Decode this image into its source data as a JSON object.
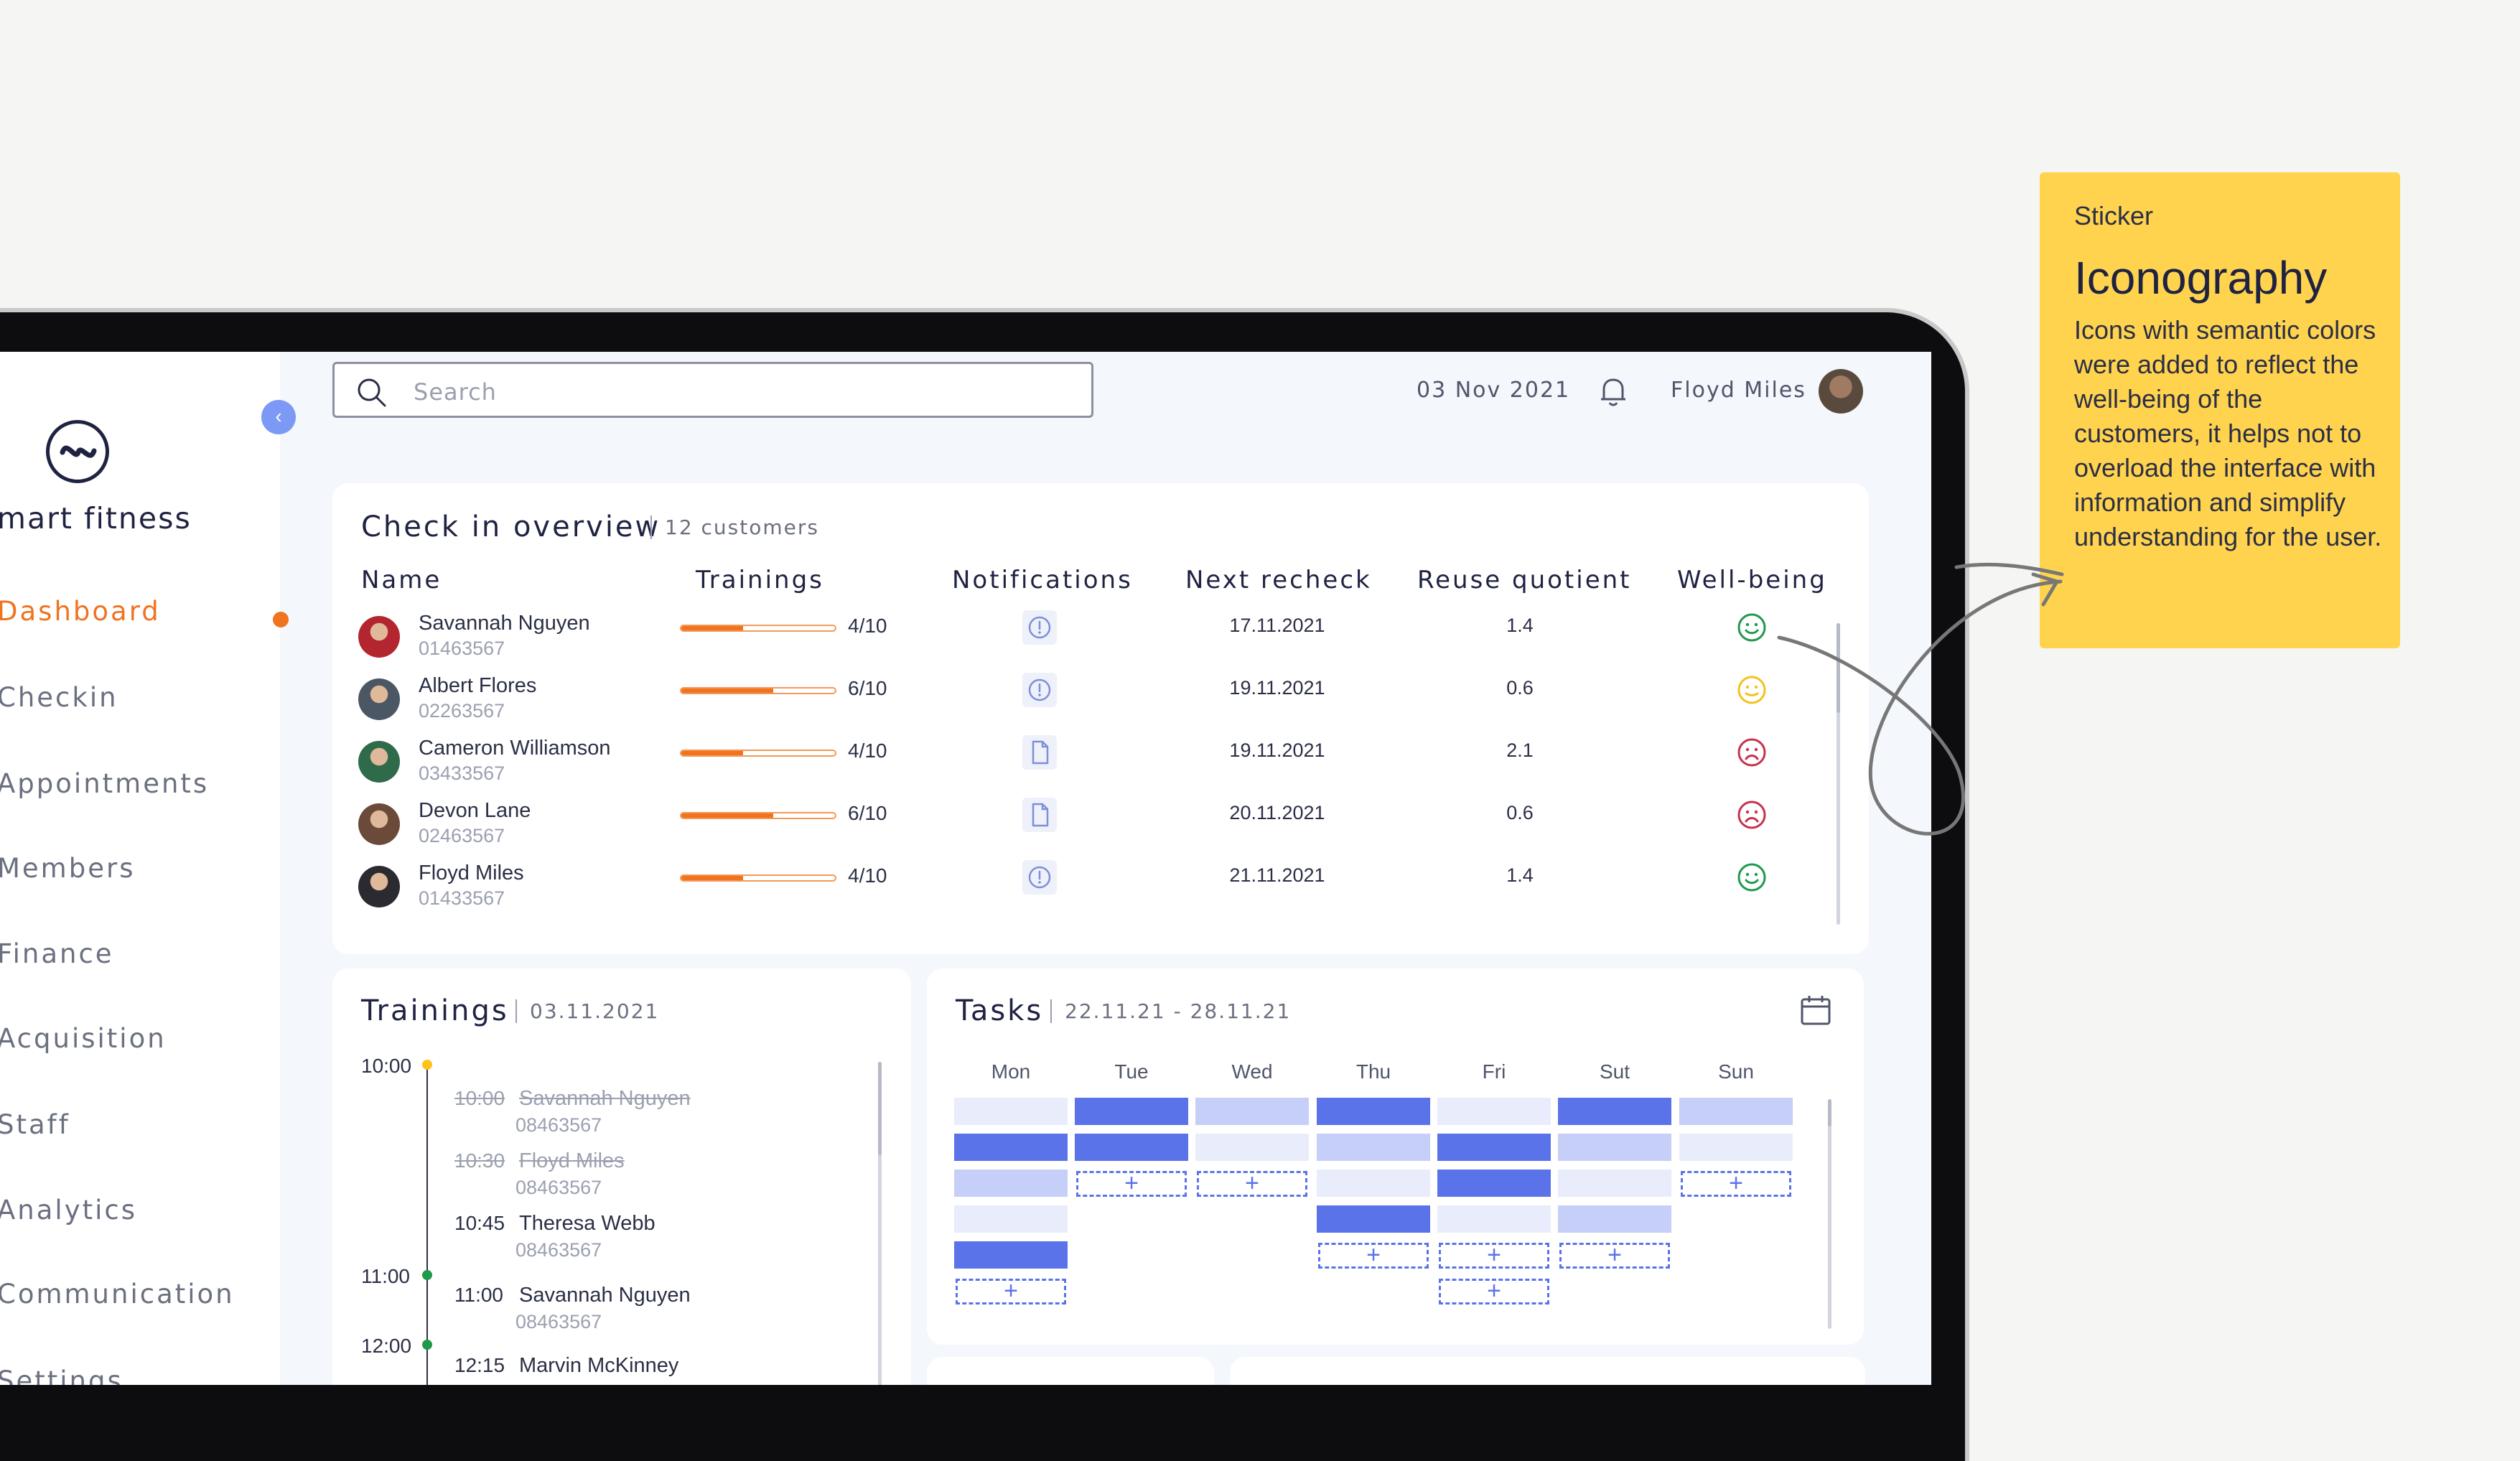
{
  "app": {
    "brand": "mart fitness",
    "nav": [
      {
        "label": "Dashboard",
        "active": true
      },
      {
        "label": "Checkin",
        "active": false
      },
      {
        "label": "Appointments",
        "active": false
      },
      {
        "label": "Members",
        "active": false
      },
      {
        "label": "Finance",
        "active": false
      },
      {
        "label": "Acquisition",
        "active": false
      },
      {
        "label": "Staff",
        "active": false
      },
      {
        "label": "Analytics",
        "active": false
      },
      {
        "label": "Communication",
        "active": false
      },
      {
        "label": "Settings",
        "active": false
      }
    ]
  },
  "topbar": {
    "search_placeholder": "Search",
    "date": "03 Nov 2021",
    "user_name": "Floyd Miles"
  },
  "checkin": {
    "title": "Check in overview",
    "count": "12 customers",
    "columns": [
      "Name",
      "Trainings",
      "Notifications",
      "Next recheck",
      "Reuse quotient",
      "Well-being"
    ],
    "rows": [
      {
        "name": "Savannah Nguyen",
        "id": "01463567",
        "trainings": "4/10",
        "progress": 0.4,
        "notification": "alert-icon",
        "recheck": "17.11.2021",
        "quotient": "1.4",
        "wellbeing": "happy",
        "avatar_color": "#b3262f"
      },
      {
        "name": "Albert Flores",
        "id": "02263567",
        "trainings": "6/10",
        "progress": 0.6,
        "notification": "alert-icon",
        "recheck": "19.11.2021",
        "quotient": "0.6",
        "wellbeing": "neutral",
        "avatar_color": "#4c5766"
      },
      {
        "name": "Cameron Williamson",
        "id": "03433567",
        "trainings": "4/10",
        "progress": 0.4,
        "notification": "document-icon",
        "recheck": "19.11.2021",
        "quotient": "2.1",
        "wellbeing": "sad",
        "avatar_color": "#2f6b4a"
      },
      {
        "name": "Devon Lane",
        "id": "02463567",
        "trainings": "6/10",
        "progress": 0.6,
        "notification": "document-icon",
        "recheck": "20.11.2021",
        "quotient": "0.6",
        "wellbeing": "sad",
        "avatar_color": "#6b4a3a"
      },
      {
        "name": "Floyd Miles",
        "id": "01433567",
        "trainings": "4/10",
        "progress": 0.4,
        "notification": "alert-icon",
        "recheck": "21.11.2021",
        "quotient": "1.4",
        "wellbeing": "happy",
        "avatar_color": "#2a2a30"
      }
    ],
    "colors": {
      "happy": "#1e9a4a",
      "neutral": "#f2c31a",
      "sad": "#c8324a",
      "alert": "#7c8fd8"
    }
  },
  "trainings": {
    "title": "Trainings",
    "date": "03.11.2021",
    "hours": [
      "10:00",
      "11:00",
      "12:00"
    ],
    "entries": [
      {
        "time": "10:00",
        "name": "Savannah Nguyen",
        "id": "08463567",
        "done": true
      },
      {
        "time": "10:30",
        "name": "Floyd Miles",
        "id": "08463567",
        "done": true
      },
      {
        "time": "10:45",
        "name": "Theresa Webb",
        "id": "08463567",
        "done": false
      },
      {
        "time": "11:00",
        "name": "Savannah Nguyen",
        "id": "08463567",
        "done": false
      },
      {
        "time": "12:15",
        "name": "Marvin McKinney",
        "id": "",
        "done": false
      }
    ]
  },
  "tasks": {
    "title": "Tasks",
    "range": "22.11.21 - 28.11.21",
    "days": [
      "Mon",
      "Tue",
      "Wed",
      "Thu",
      "Fri",
      "Sut",
      "Sun"
    ],
    "add_symbol": "+"
  },
  "sticker": {
    "kicker": "Sticker",
    "title": "Iconography",
    "body": "Icons with semantic colors were added to reflect the well-being of the customers, it helps not to overload the interface with information and simplify understanding for the user."
  }
}
